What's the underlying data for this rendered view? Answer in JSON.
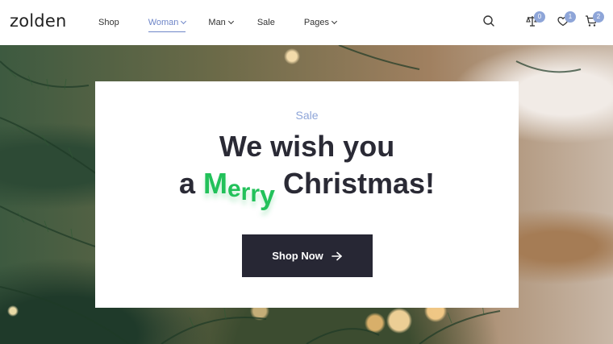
{
  "brand": {
    "logo": "zolden"
  },
  "nav": [
    {
      "label": "Shop",
      "dropdown": false,
      "active": false
    },
    {
      "label": "Woman",
      "dropdown": true,
      "active": true
    },
    {
      "label": "Man",
      "dropdown": true,
      "active": false
    },
    {
      "label": "Sale",
      "dropdown": false,
      "active": false
    },
    {
      "label": "Pages",
      "dropdown": true,
      "active": false
    }
  ],
  "header_icons": {
    "search": {
      "icon": "search-icon"
    },
    "compare": {
      "icon": "scale-icon",
      "count": "0"
    },
    "wishlist": {
      "icon": "heart-icon",
      "count": "1"
    },
    "cart": {
      "icon": "cart-icon",
      "count": "2"
    }
  },
  "hero": {
    "label": "Sale",
    "line1": "We wish you",
    "line2_prefix": "a",
    "line2_highlight": [
      "M",
      "e",
      "r",
      "r",
      "y"
    ],
    "line2_suffix": "Christmas!",
    "cta_label": "Shop Now",
    "cta_icon": "arrow-right-icon"
  },
  "colors": {
    "accent": "#8ea5d8",
    "highlight_green": "#22c15a",
    "button_bg": "#272734",
    "text_dark": "#2a2a35"
  }
}
